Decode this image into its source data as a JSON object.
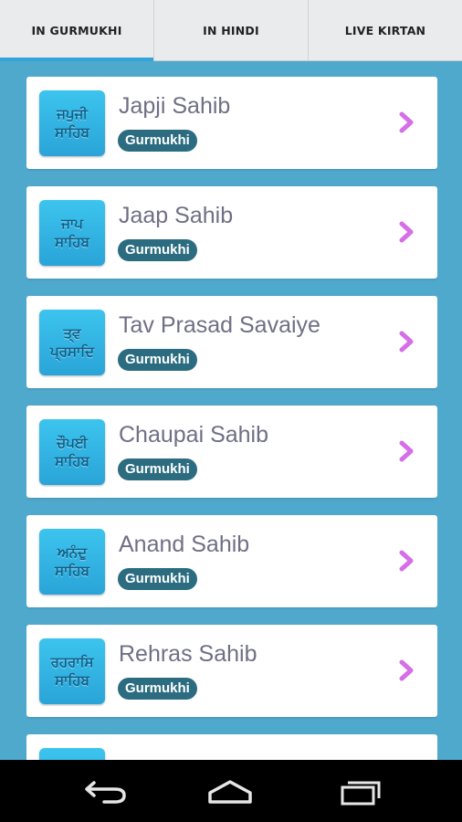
{
  "tabs": [
    {
      "label": "IN GURMUKHI",
      "active": true
    },
    {
      "label": "IN HINDI",
      "active": false
    },
    {
      "label": "LIVE KIRTAN",
      "active": false
    }
  ],
  "items": [
    {
      "title": "Japji Sahib",
      "badge": "Gurmukhi",
      "thumb_top": "ਜਪੁਜੀ",
      "thumb_bottom": "ਸਾਹਿਬ"
    },
    {
      "title": "Jaap Sahib",
      "badge": "Gurmukhi",
      "thumb_top": "ਜਾਪ",
      "thumb_bottom": "ਸਾਹਿਬ"
    },
    {
      "title": "Tav Prasad Savaiye",
      "badge": "Gurmukhi",
      "thumb_top": "ਤ੍ਵ",
      "thumb_bottom": "ਪ੍ਰਸਾਦਿ"
    },
    {
      "title": "Chaupai Sahib",
      "badge": "Gurmukhi",
      "thumb_top": "ਚੌਪਈ",
      "thumb_bottom": "ਸਾਹਿਬ"
    },
    {
      "title": "Anand Sahib",
      "badge": "Gurmukhi",
      "thumb_top": "ਅਨੰਦੁ",
      "thumb_bottom": "ਸਾਹਿਬ"
    },
    {
      "title": "Rehras Sahib",
      "badge": "Gurmukhi",
      "thumb_top": "ਰਹਰਾਸਿ",
      "thumb_bottom": "ਸਾਹਿਬ"
    },
    {
      "title": "",
      "badge": "",
      "thumb_top": "",
      "thumb_bottom": ""
    }
  ],
  "icons": {
    "chevron": "chevron-right-icon",
    "back": "back-icon",
    "home": "home-icon",
    "recent": "recent-apps-icon"
  },
  "colors": {
    "background": "#4fa9cc",
    "tab_indicator": "#34a3d9",
    "badge": "#2b6c80",
    "chevron": "#d66ee8",
    "title": "#6f6f86"
  }
}
